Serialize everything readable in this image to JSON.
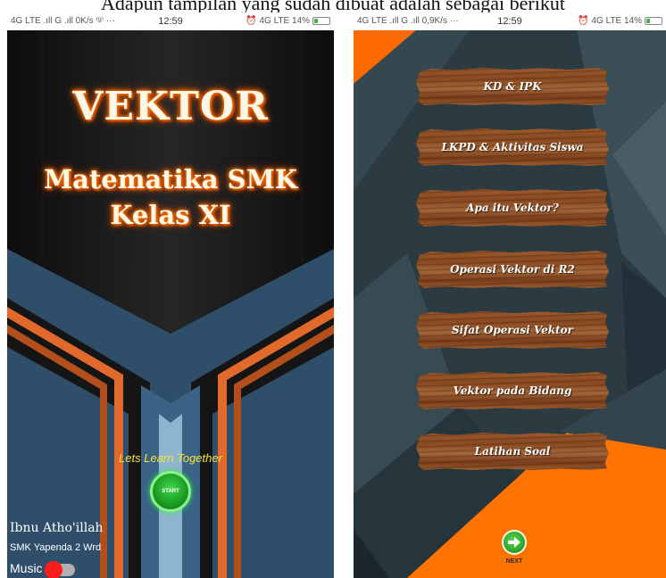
{
  "document": {
    "caption_fragment": "Adapun tampilan yang sudah dibuat adalah sebagai berikut"
  },
  "left_phone": {
    "status": {
      "left": "4G LTE .ıll G .ıll 0K/s ⁽ᵍ⁾ ···",
      "time": "12:59",
      "right": "⏰ 4G LTE 14%"
    },
    "title": "VEKTOR",
    "subtitle_line1": "Matematika SMK",
    "subtitle_line2": "Kelas XI",
    "tagline": "Lets Learn Together",
    "start_label": "START",
    "author": "Ibnu Atho'illah",
    "school": "SMK Yapenda 2 Wrd",
    "music_label": "Music",
    "music_on": false
  },
  "right_phone": {
    "status": {
      "left": "4G LTE .ıll G .ıll 0,9K/s ···",
      "time": "12:59",
      "right": "⏰ 4G LTE 14%"
    },
    "menu": [
      {
        "label": "KD & IPK"
      },
      {
        "label": "LKPD & Aktivitas Siswa"
      },
      {
        "label": "Apa itu Vektor?"
      },
      {
        "label": "Operasi Vektor di R2"
      },
      {
        "label": "Sifat Operasi Vektor"
      },
      {
        "label": "Vektor pada Bidang"
      },
      {
        "label": "Latihan Soal"
      }
    ],
    "next_label": "NEXT"
  },
  "colors": {
    "accent_orange": "#ff6a00",
    "steel_blue": "#2f4e6a",
    "dark_slate": "#2c3a41",
    "wood": "#8a4a22",
    "start_green": "#1a9a22",
    "toggle_red": "#ff1c1c",
    "tagline_yellow": "#f3e43a"
  }
}
